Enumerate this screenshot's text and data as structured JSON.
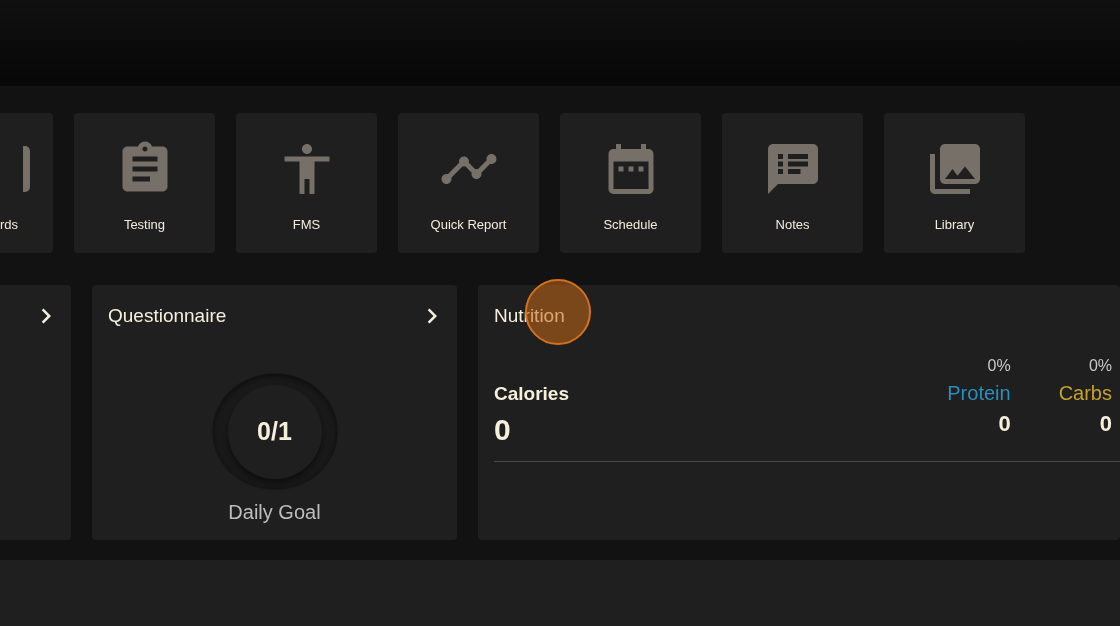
{
  "tiles": [
    {
      "label": "rds",
      "kind": "cards"
    },
    {
      "label": "Testing",
      "kind": "clipboard"
    },
    {
      "label": "FMS",
      "kind": "person"
    },
    {
      "label": "Quick Report",
      "kind": "trend"
    },
    {
      "label": "Schedule",
      "kind": "calendar"
    },
    {
      "label": "Notes",
      "kind": "notes"
    },
    {
      "label": "Library",
      "kind": "photos"
    }
  ],
  "questionnaire": {
    "title": "Questionnaire",
    "progress": "0/1",
    "caption": "Daily Goal"
  },
  "nutrition": {
    "title": "Nutrition",
    "calories_label": "Calories",
    "calories_value": "0",
    "macros": [
      {
        "percent": "0%",
        "name": "Protein",
        "value": "0",
        "color": "#2a8fbd"
      },
      {
        "percent": "0%",
        "name": "Carbs",
        "value": "0",
        "color": "#c4a12a"
      }
    ]
  }
}
